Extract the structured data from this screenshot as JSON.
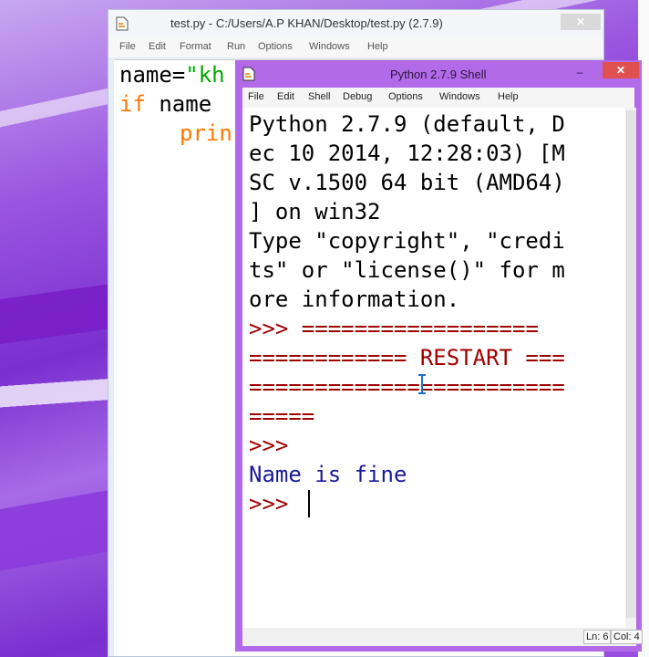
{
  "editor": {
    "title": "test.py - C:/Users/A.P KHAN/Desktop/test.py (2.7.9)",
    "minimize_glyph": "–",
    "maximize_glyph": "□",
    "close_glyph": "✕",
    "menu": [
      "File",
      "Edit",
      "Format",
      "Run",
      "Options",
      "Windows",
      "Help"
    ],
    "code": {
      "line1_text": "name=",
      "line1_string": "\"kh",
      "line2_keyword": "if",
      "line2_text": " name",
      "line3_keyword": "prin"
    }
  },
  "shell": {
    "title": "Python 2.7.9 Shell",
    "minimize_glyph": "–",
    "maximize_glyph": "□",
    "close_glyph": "✕",
    "menu": [
      "File",
      "Edit",
      "Shell",
      "Debug",
      "Options",
      "Windows",
      "Help"
    ],
    "banner_lines": [
      "Python 2.7.9 (default, D",
      "ec 10 2014, 12:28:03) [M",
      "SC v.1500 64 bit (AMD64)",
      "] on win32",
      "Type \"copyright\", \"credi",
      "ts\" or \"license()\" for m",
      "ore information."
    ],
    "prompt": ">>>",
    "restart_first": " ==================",
    "restart_lines": [
      "============ RESTART ===",
      "========================",
      "====="
    ],
    "output": "Name is fine",
    "status": {
      "line": "Ln: 6",
      "col": "Col: 4"
    }
  },
  "colors": {
    "keyword": "#ff7700",
    "string": "#00aa00",
    "prompt": "#a00000",
    "output": "#1a1a99",
    "shell_frame": "#b36ae8"
  }
}
